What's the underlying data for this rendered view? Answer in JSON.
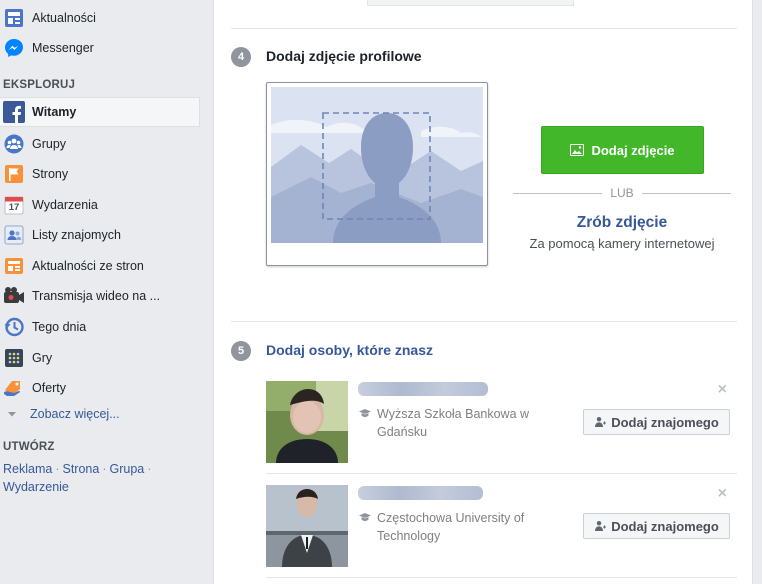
{
  "sidebar": {
    "top_items": [
      {
        "label": "Aktualności",
        "icon": "news-feed-icon"
      },
      {
        "label": "Messenger",
        "icon": "messenger-icon"
      }
    ],
    "explore_heading": "EKSPLORUJ",
    "explore_items": [
      {
        "label": "Witamy",
        "icon": "facebook-icon",
        "active": true
      },
      {
        "label": "Grupy",
        "icon": "groups-icon"
      },
      {
        "label": "Strony",
        "icon": "pages-flag-icon"
      },
      {
        "label": "Wydarzenia",
        "icon": "calendar-icon",
        "calendar_day": "17"
      },
      {
        "label": "Listy znajomych",
        "icon": "friend-lists-icon"
      },
      {
        "label": "Aktualności ze stron",
        "icon": "pages-feed-icon"
      },
      {
        "label": "Transmisja wideo na ...",
        "icon": "live-video-icon"
      },
      {
        "label": "Tego dnia",
        "icon": "on-this-day-icon"
      },
      {
        "label": "Gry",
        "icon": "games-icon"
      },
      {
        "label": "Oferty",
        "icon": "offers-icon"
      }
    ],
    "see_more": "Zobacz więcej...",
    "create_heading": "UTWÓRZ",
    "create_links": [
      "Reklama",
      "Strona",
      "Grupa",
      "Wydarzenie"
    ],
    "separator": "·"
  },
  "main": {
    "step4": {
      "number": "4",
      "title": "Dodaj zdjęcie profilowe",
      "add_photo_button": "Dodaj zdjęcie",
      "or_text": "LUB",
      "take_photo": "Zrób zdjęcie",
      "take_photo_sub": "Za pomocą kamery internetowej"
    },
    "step5": {
      "number": "5",
      "title": "Dodaj osoby, które znasz",
      "people": [
        {
          "school": "Wyższa Szkoła Bankowa w Gdańsku",
          "button": "Dodaj znajomego",
          "close": "×"
        },
        {
          "school": "Częstochowa University of Technology",
          "button": "Dodaj znajomego",
          "close": "×"
        }
      ]
    }
  },
  "colors": {
    "accent_blue": "#365899",
    "green_button": "#42b72a",
    "sidebar_bg": "#e9ebee"
  }
}
